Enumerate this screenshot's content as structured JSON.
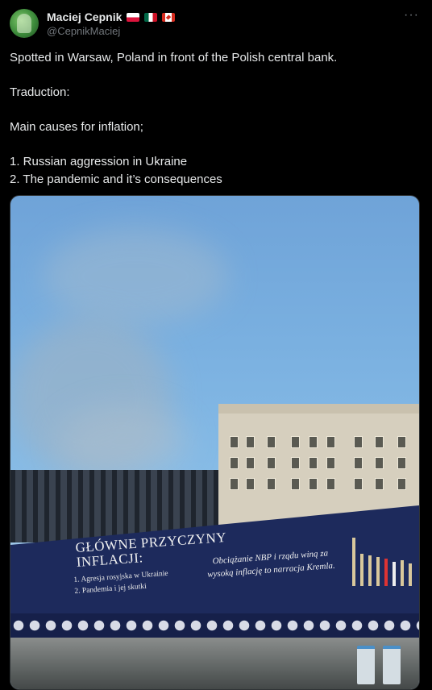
{
  "author": {
    "display_name": "Maciej Cepnik",
    "handle": "@CepnikMaciej",
    "flags": [
      "poland-flag",
      "mexico-flag",
      "canada-flag"
    ]
  },
  "menu": {
    "more_icon": "more-horizontal-icon",
    "more_glyph": "···"
  },
  "tweet": {
    "lines": [
      "Spotted in Warsaw, Poland in front of the Polish central bank.",
      "",
      "Traduction:",
      "",
      "Main causes for inflation;",
      "",
      "1. Russian aggression in Ukraine",
      "2. The pandemic and it’s consequences"
    ]
  },
  "media": {
    "banner_title": "GŁÓWNE PRZYCZYNY\nINFLACJI:",
    "banner_items": [
      "1. Agresja rosyjska w Ukrainie",
      "2. Pandemia i jej skutki"
    ],
    "banner_quote": "Obciążanie NBP i rządu winą za wysoką inflację to narracja Kremla.",
    "colors": {
      "banner": "#1d2a5c",
      "sky": "#7ab0e0"
    }
  }
}
